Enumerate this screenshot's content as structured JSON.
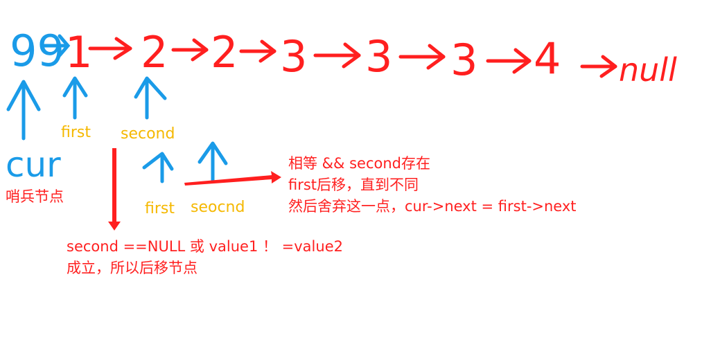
{
  "colors": {
    "list_red": "#ff1f1f",
    "pointer_blue": "#1a9be8",
    "label_yellow": "#f5b800",
    "note_red": "#ff2020"
  },
  "list": {
    "dummy": "99",
    "nodes": [
      "1",
      "2",
      "2",
      "3",
      "3",
      "3",
      "4"
    ],
    "tail": "null"
  },
  "pointers": {
    "cur": "cur",
    "sentinel": "哨兵节点",
    "first_top": "first",
    "second_top": "second",
    "first_bottom": "first",
    "second_bottom": "seocnd"
  },
  "notes": {
    "right": [
      "相等 && second存在",
      "first后移，直到不同",
      "然后舍弃这一点，cur->next = first->next"
    ],
    "bottom": [
      "second ==NULL 或 value1 ！ =value2",
      "成立，所以后移节点"
    ]
  }
}
